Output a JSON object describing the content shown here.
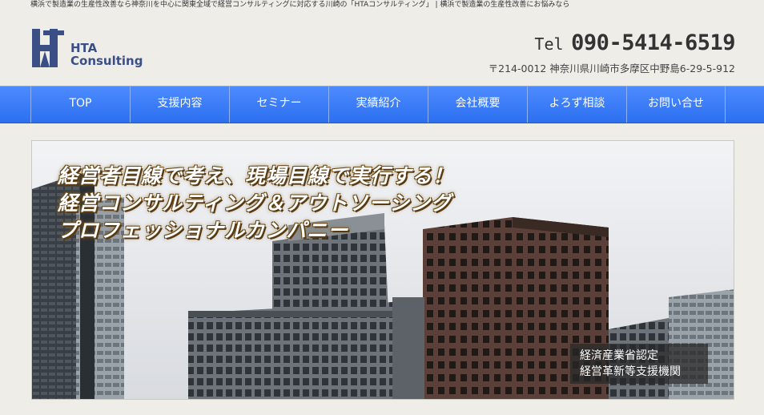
{
  "top_banner": {
    "text": "横浜で製造業の生産性改善なら神奈川を中心に関東全域で経営コンサルティングに対応する川崎の「HTAコンサルティング」 | 横浜で製造業の生産性改善にお悩みなら"
  },
  "header": {
    "logo_line1": "HTA",
    "logo_line2": "Consulting",
    "tel_label": "Tel",
    "tel_number": "090-5414-6519",
    "address": "〒214-0012 神奈川県川崎市多摩区中野島6-29-5-912"
  },
  "nav": {
    "items": [
      {
        "label": "TOP"
      },
      {
        "label": "支援内容"
      },
      {
        "label": "セミナー"
      },
      {
        "label": "実績紹介"
      },
      {
        "label": "会社概要"
      },
      {
        "label": "よろず相談"
      },
      {
        "label": "お問い合せ"
      }
    ]
  },
  "hero": {
    "slogan_line1": "経営者目線で考え、現場目線で実行する！",
    "slogan_line2": "経営コンサルティング＆アウトソーシング",
    "slogan_line3": "プロフェッショナルカンパニー",
    "badge_line1": "経済産業省認定",
    "badge_line2": "経営革新等支援機関"
  },
  "colors": {
    "nav_blue": "#3a7cf6",
    "logo_navy": "#3a4f86",
    "page_bg": "#eeede8"
  }
}
